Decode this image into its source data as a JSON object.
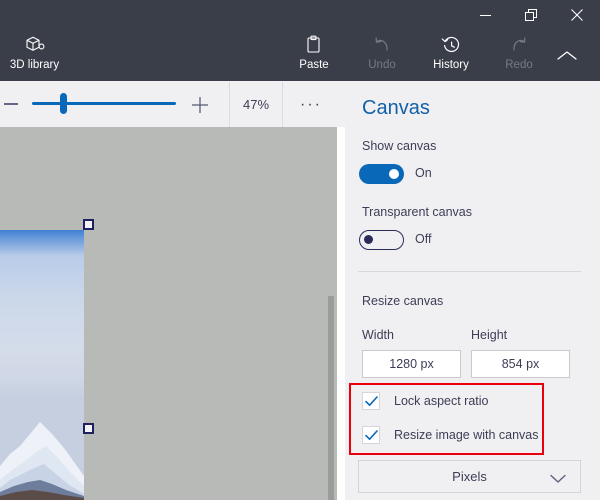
{
  "window": {
    "controls": [
      {
        "name": "minimize",
        "glyph": "minimize-icon"
      },
      {
        "name": "restore",
        "glyph": "restore-icon"
      },
      {
        "name": "close",
        "glyph": "close-icon"
      }
    ]
  },
  "ribbon": {
    "items": [
      {
        "label": "3D library",
        "icon": "cube-3d-icon",
        "enabled": true
      },
      {
        "label": "Paste",
        "icon": "clipboard-icon",
        "enabled": true
      },
      {
        "label": "Undo",
        "icon": "undo-arrow-icon",
        "enabled": false
      },
      {
        "label": "History",
        "icon": "history-clock-icon",
        "enabled": true
      },
      {
        "label": "Redo",
        "icon": "redo-arrow-icon",
        "enabled": false
      }
    ],
    "collapse_icon": "chevron-up-icon"
  },
  "zoombar": {
    "minus_icon": "minus-icon",
    "plus_icon": "plus-icon",
    "zoom_level": "47%",
    "more_label": "···",
    "slider_value": 20
  },
  "panel": {
    "title": "Canvas",
    "show_canvas": {
      "label": "Show canvas",
      "state": "On",
      "on": true
    },
    "transparent_canvas": {
      "label": "Transparent canvas",
      "state": "Off",
      "on": false
    },
    "resize": {
      "section_label": "Resize canvas",
      "width_label": "Width",
      "height_label": "Height",
      "width_value": "1280 px",
      "height_value": "854 px",
      "checkboxes": [
        {
          "label": "Lock aspect ratio",
          "checked": true
        },
        {
          "label": "Resize image with canvas",
          "checked": true
        }
      ],
      "unit_dropdown": {
        "value": "Pixels",
        "chevron": "chevron-down-icon"
      }
    }
  },
  "colors": {
    "ribbon_bg": "#3a3e49",
    "panel_bg": "#f0f0f2",
    "accent_blue": "#0a68b8",
    "title_blue": "#1261a8",
    "canvas_gray": "#b8bab8",
    "annotation_red": "#e8000c",
    "text_dark": "#3d3d56",
    "disabled_gray": "#767a85"
  }
}
